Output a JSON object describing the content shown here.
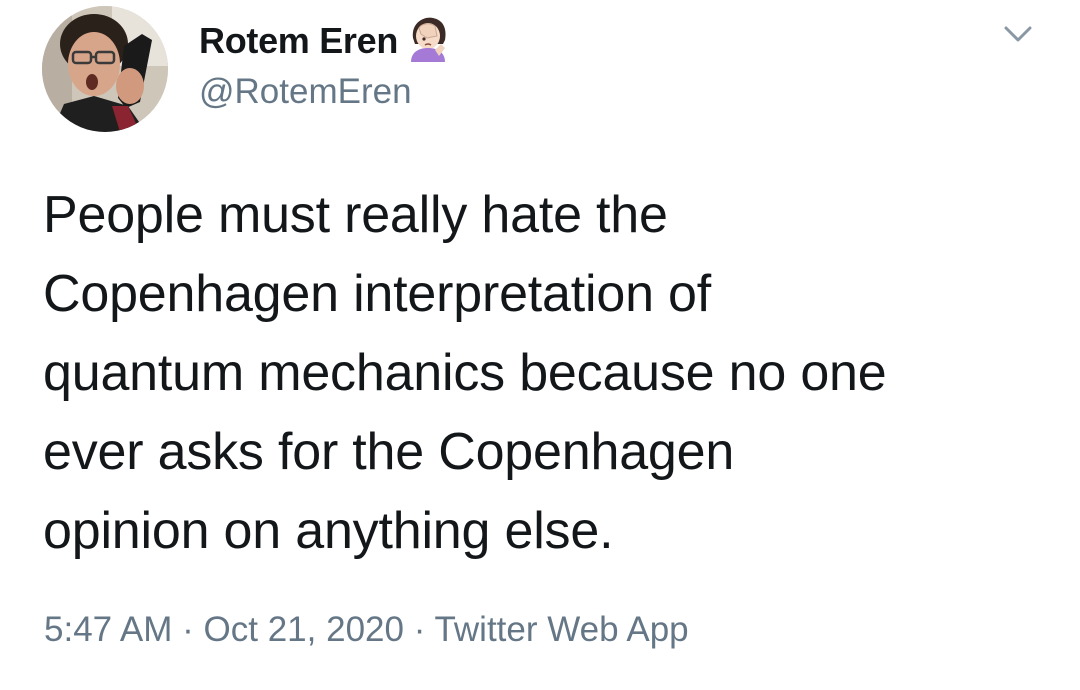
{
  "user": {
    "display_name": "Rotem Eren",
    "name_emoji": "woman-facepalming-emoji",
    "handle": "@RotemEren",
    "avatar": "profile-photo"
  },
  "tweet": {
    "text": "People must really hate the\nCopenhagen interpretation of\nquantum mechanics because no one\never asks for the Copenhagen\nopinion on anything else.",
    "time": "5:47 AM",
    "separator": "·",
    "date": "Oct 21, 2020",
    "source": "Twitter Web App"
  },
  "icons": {
    "menu": "chevron-down-icon"
  },
  "colors": {
    "text": "#14171a",
    "secondary": "#657786",
    "background": "#ffffff"
  }
}
